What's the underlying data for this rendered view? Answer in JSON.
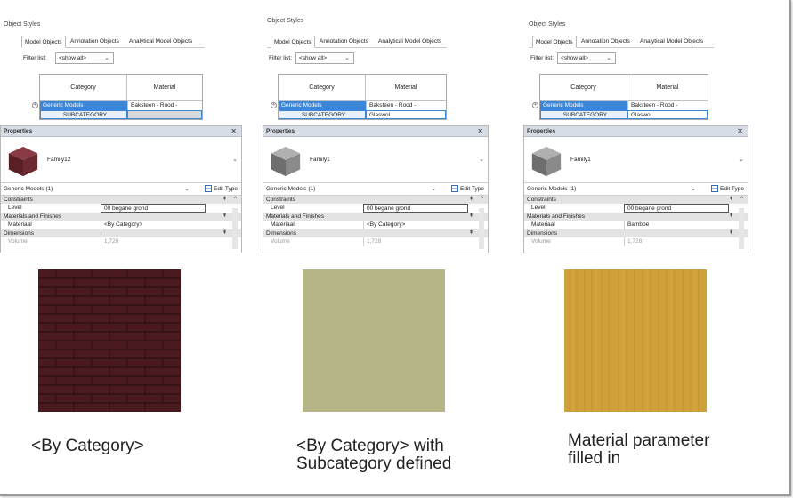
{
  "panels": [
    {
      "object_styles": {
        "title": "Object Styles",
        "tabs": [
          "Model Objects",
          "Annotation Objects",
          "Analytical Model Objects"
        ],
        "filter_label": "Filter list:",
        "filter_value": "<show all>",
        "col_category": "Category",
        "col_material": "Material",
        "row_category": "Generic Models",
        "row_material": "Baksteen - Rood -",
        "sub_category": "SUBCATEGORY",
        "sub_material": ""
      },
      "properties": {
        "title": "Properties",
        "family": "Family12",
        "instance": "Generic Models (1)",
        "edit_type": "Edit Type",
        "section_constraints": "Constraints",
        "level_label": "Level",
        "level_value": "00 begane grond",
        "section_materials": "Materials and Finishes",
        "material_label": "Materiaal",
        "material_value": "<By Category>",
        "section_dimensions": "Dimensions",
        "volume_label": "Volume",
        "volume_value": "1,728"
      },
      "caption": "<By Category>"
    },
    {
      "object_styles": {
        "title": "Object Styles",
        "tabs": [
          "Model Objects",
          "Annotation Objects",
          "Analytical Model Objects"
        ],
        "filter_label": "Filter list:",
        "filter_value": "<show all>",
        "col_category": "Category",
        "col_material": "Material",
        "row_category": "Generic Models",
        "row_material": "Baksteen - Rood -",
        "sub_category": "SUBCATEGORY",
        "sub_material": "Glaswol"
      },
      "properties": {
        "title": "Properties",
        "family": "Family1",
        "instance": "Generic Models (1)",
        "edit_type": "Edit Type",
        "section_constraints": "Constraints",
        "level_label": "Level",
        "level_value": "00 begane grond",
        "section_materials": "Materials and Finishes",
        "material_label": "Materiaal",
        "material_value": "<By Category>",
        "section_dimensions": "Dimensions",
        "volume_label": "Volume",
        "volume_value": "1,728"
      },
      "caption_line1": "<By Category> with",
      "caption_line2": "Subcategory defined"
    },
    {
      "object_styles": {
        "title": "Object Styles",
        "tabs": [
          "Model Objects",
          "Annotation Objects",
          "Analytical Model Objects"
        ],
        "filter_label": "Filter list:",
        "filter_value": "<show all>",
        "col_category": "Category",
        "col_material": "Material",
        "row_category": "Generic Models",
        "row_material": "Baksteen - Rood -",
        "sub_category": "SUBCATEGORY",
        "sub_material": "Glaswol"
      },
      "properties": {
        "title": "Properties",
        "family": "Family1",
        "instance": "Generic Models (1)",
        "edit_type": "Edit Type",
        "section_constraints": "Constraints",
        "level_label": "Level",
        "level_value": "00 begane grond",
        "section_materials": "Materials and Finishes",
        "material_label": "Materiaal",
        "material_value": "Bamboe",
        "section_dimensions": "Dimensions",
        "volume_label": "Volume",
        "volume_value": "1,728"
      },
      "caption_line1": "Material parameter",
      "caption_line2": "filled in"
    }
  ],
  "colors": {
    "brick": "#4a1a1f",
    "glaswol": "#b5b585",
    "bamboe": "#cfa13a",
    "cube_red": "#6b2a32",
    "cube_grey": "#8a8a8a",
    "selection": "#3c86d8"
  }
}
